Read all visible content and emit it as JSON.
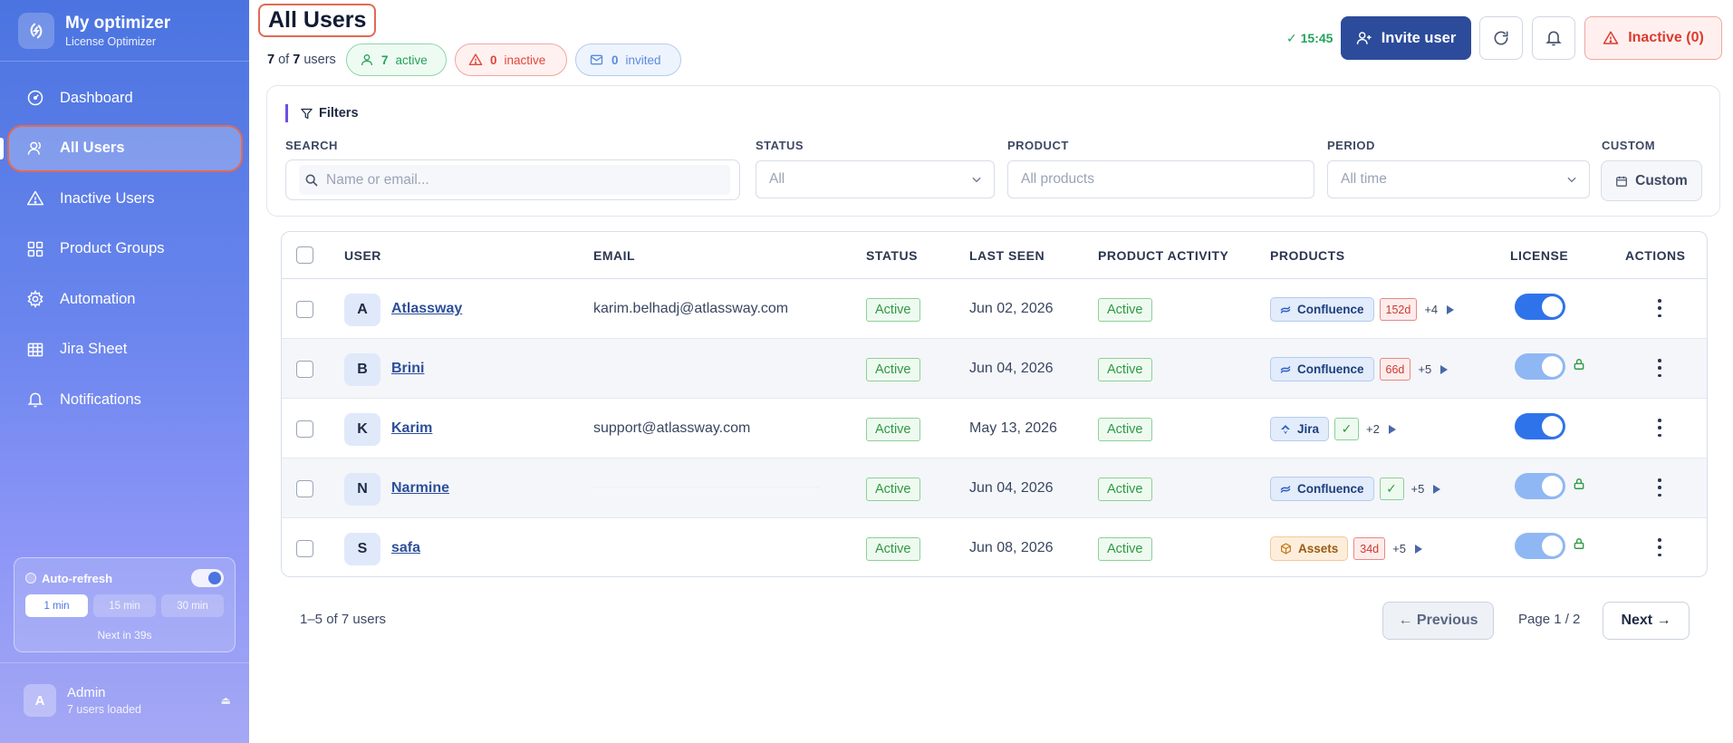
{
  "brand": {
    "title": "My optimizer",
    "subtitle": "License Optimizer"
  },
  "sidebar": {
    "items": [
      {
        "label": "Dashboard",
        "icon": "dashboard-icon"
      },
      {
        "label": "All Users",
        "icon": "users-icon",
        "active": true
      },
      {
        "label": "Inactive Users",
        "icon": "warning-icon"
      },
      {
        "label": "Product Groups",
        "icon": "grid-icon"
      },
      {
        "label": "Automation",
        "icon": "gear-icon"
      },
      {
        "label": "Jira Sheet",
        "icon": "table-icon"
      },
      {
        "label": "Notifications",
        "icon": "bell-icon"
      }
    ],
    "auto_refresh": {
      "label": "Auto-refresh",
      "intervals": [
        "1 min",
        "15 min",
        "30 min"
      ],
      "selected": "1 min",
      "next": "Next in 39s"
    },
    "admin": {
      "initial": "A",
      "name": "Admin",
      "sub": "7 users loaded"
    }
  },
  "header": {
    "title": "All Users",
    "count_shown": "7",
    "count_of": "of",
    "count_total": "7",
    "count_suffix": "users",
    "active_count": "7",
    "active_label": "active",
    "inactive_count": "0",
    "inactive_label": "inactive",
    "invited_count": "0",
    "invited_label": "invited",
    "time": "✓ 15:45",
    "invite_label": "Invite user",
    "inactive_button": "Inactive (0)"
  },
  "filters": {
    "title": "Filters",
    "search_label": "SEARCH",
    "search_placeholder": "Name or email...",
    "status_label": "STATUS",
    "status_value": "All",
    "product_label": "PRODUCT",
    "product_value": "All products",
    "period_label": "PERIOD",
    "period_value": "All time",
    "custom_label": "CUSTOM",
    "custom_button": "Custom"
  },
  "table": {
    "columns": [
      "USER",
      "EMAIL",
      "STATUS",
      "LAST SEEN",
      "PRODUCT ACTIVITY",
      "PRODUCTS",
      "LICENSE",
      "ACTIONS"
    ],
    "rows": [
      {
        "initial": "A",
        "name": "Atlassway",
        "email": "karim.belhadj@atlassway.com",
        "status": "Active",
        "last_seen": "Jun 02, 2026",
        "activity": "Active",
        "product": "Confluence",
        "product_icon": "confluence-icon",
        "days": "152d",
        "more": "+4",
        "license_on": true,
        "locked": false
      },
      {
        "initial": "B",
        "name": "Brini",
        "email": "",
        "status": "Active",
        "last_seen": "Jun 04, 2026",
        "activity": "Active",
        "product": "Confluence",
        "product_icon": "confluence-icon",
        "days": "66d",
        "more": "+5",
        "license_on": true,
        "locked": true
      },
      {
        "initial": "K",
        "name": "Karim",
        "email": "support@atlassway.com",
        "status": "Active",
        "last_seen": "May 13, 2026",
        "activity": "Active",
        "product": "Jira",
        "product_icon": "jira-icon",
        "days": "",
        "check": "✓",
        "more": "+2",
        "license_on": true,
        "locked": false
      },
      {
        "initial": "N",
        "name": "Narmine",
        "email": "",
        "status": "Active",
        "last_seen": "Jun 04, 2026",
        "activity": "Active",
        "product": "Confluence",
        "product_icon": "confluence-icon",
        "days": "",
        "check": "✓",
        "more": "+5",
        "license_on": true,
        "locked": true
      },
      {
        "initial": "S",
        "name": "safa",
        "email": "",
        "status": "Active",
        "last_seen": "Jun 08, 2026",
        "activity": "Active",
        "product": "Assets",
        "product_icon": "assets-icon",
        "days": "34d",
        "more": "+5",
        "license_on": true,
        "locked": true
      }
    ]
  },
  "pagination": {
    "range": "1–5 of 7 users",
    "prev": "← Previous",
    "page": "Page 1 / 2",
    "next": "Next →"
  }
}
